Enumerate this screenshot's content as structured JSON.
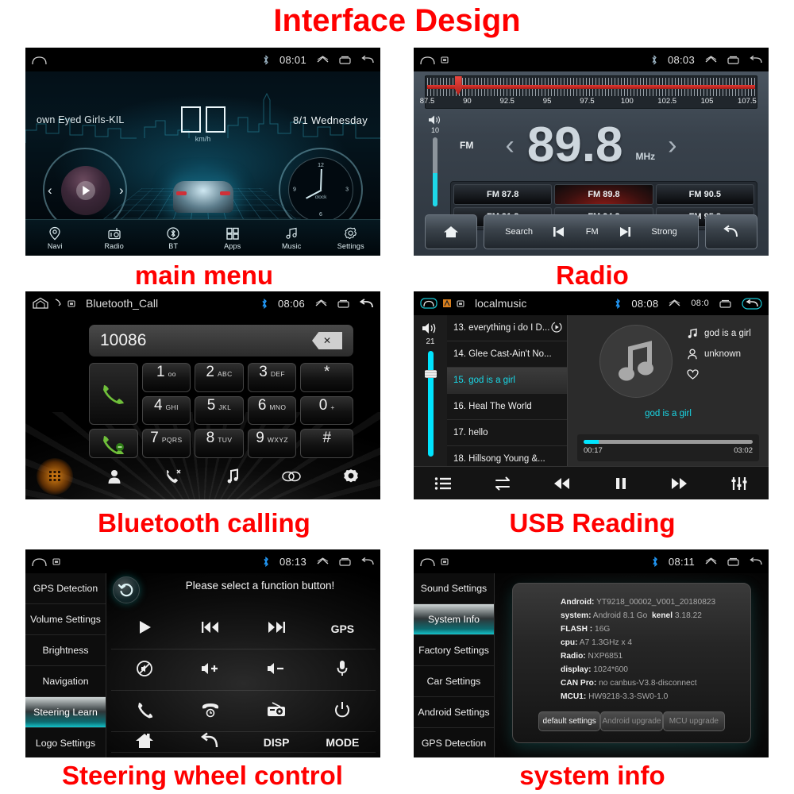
{
  "title": "Interface Design",
  "captions": {
    "main_menu": "main menu",
    "radio": "Radio",
    "bluetooth": "Bluetooth calling",
    "usb": "USB Reading",
    "steering": "Steering wheel control",
    "system": "system info"
  },
  "colors": {
    "caption_red": "#ff0000",
    "accent_cyan": "#19d7e6",
    "accent_red": "#c2201b",
    "bluetooth_blue": "#2196f3",
    "call_green": "#6fbf3a"
  },
  "main_menu": {
    "status": {
      "time": "08:01",
      "bluetooth_icon": "bluetooth-icon",
      "home_icon": "home-icon",
      "up_icon": "chevron-up-icon",
      "recents_icon": "recents-icon",
      "back_icon": "back-icon"
    },
    "track": "own Eyed Girls-KIL",
    "date": "8/1  Wednesday",
    "speed_unit": "km/h",
    "clock_label": "clock",
    "clock_numbers": [
      "12",
      "3",
      "6",
      "9"
    ],
    "taskbar": [
      {
        "label": "Navi",
        "icon": "location-pin-icon"
      },
      {
        "label": "Radio",
        "icon": "radio-icon"
      },
      {
        "label": "BT",
        "icon": "bluetooth-icon"
      },
      {
        "label": "Apps",
        "icon": "grid-apps-icon"
      },
      {
        "label": "Music",
        "icon": "music-note-icon"
      },
      {
        "label": "Settings",
        "icon": "gear-icon"
      }
    ]
  },
  "radio": {
    "status": {
      "time": "08:03"
    },
    "scale_labels": [
      "87.5",
      "90",
      "92.5",
      "95",
      "97.5",
      "100",
      "102.5",
      "105",
      "107.5"
    ],
    "scale_min": 87.5,
    "scale_max": 108.0,
    "tuned_frequency": 89.3,
    "volume": "10",
    "band": "FM",
    "frequency": "89.8",
    "unit": "MHz",
    "prev_icon": "chevron-left-icon",
    "next_icon": "chevron-right-icon",
    "presets": [
      "FM 87.8",
      "FM 89.8",
      "FM 90.5",
      "FM 91.8",
      "FM 94.2",
      "FM 95.8"
    ],
    "active_preset_index": 1,
    "bottom": {
      "home_icon": "home-icon",
      "search": "Search",
      "prev_icon": "skip-previous-icon",
      "band": "FM",
      "next_icon": "skip-next-icon",
      "strong": "Strong",
      "back_icon": "back-arrow-icon"
    }
  },
  "bluetooth": {
    "status": {
      "title": "Bluetooth_Call",
      "time": "08:06"
    },
    "dialed_number": "10086",
    "backspace_icon": "backspace-icon",
    "keys": [
      {
        "digit": "1",
        "sub": "oo"
      },
      {
        "digit": "2",
        "sub": "ABC"
      },
      {
        "digit": "3",
        "sub": "DEF"
      },
      {
        "digit": "*",
        "sub": ""
      },
      {
        "digit": "4",
        "sub": "GHI"
      },
      {
        "digit": "5",
        "sub": "JKL"
      },
      {
        "digit": "6",
        "sub": "MNO"
      },
      {
        "digit": "0",
        "sub": "+"
      },
      {
        "digit": "7",
        "sub": "PQRS"
      },
      {
        "digit": "8",
        "sub": "TUV"
      },
      {
        "digit": "9",
        "sub": "WXYZ"
      },
      {
        "digit": "#",
        "sub": ""
      }
    ],
    "call_icon": "phone-call-icon",
    "hangup_icon": "phone-hangup-icon",
    "tabs": [
      {
        "icon": "dialpad-icon",
        "active": true
      },
      {
        "icon": "contacts-icon",
        "active": false
      },
      {
        "icon": "call-history-icon",
        "active": false
      },
      {
        "icon": "music-note-icon",
        "active": false
      },
      {
        "icon": "link-icon",
        "active": false
      },
      {
        "icon": "gear-icon",
        "active": false
      }
    ]
  },
  "usb": {
    "status": {
      "title": "localmusic",
      "time": "08:08",
      "extra": "08:0"
    },
    "volume": "21",
    "playlist": [
      "13. everything i do I D...",
      "14. Glee Cast-Ain't No...",
      "15. god is a girl",
      "16. Heal The World",
      "17. hello",
      "18. Hillsong Young &..."
    ],
    "selected_index": 2,
    "now_playing": {
      "title": "god is a girl",
      "artist": "unknown",
      "favorite_icon": "heart-icon",
      "lyric": "god is a girl",
      "elapsed": "00:17",
      "duration": "03:02",
      "progress_percent": 9
    },
    "controls": [
      "list-icon",
      "repeat-icon",
      "skip-previous-icon",
      "pause-icon",
      "skip-next-icon",
      "equalizer-icon"
    ]
  },
  "steering": {
    "status": {
      "time": "08:13"
    },
    "menu": [
      "GPS Detection",
      "Volume Settings",
      "Brightness",
      "Navigation",
      "Steering Learn",
      "Logo Settings"
    ],
    "active_menu_index": 4,
    "hint": "Please select a function button!",
    "reset_icon": "reset-circle-icon",
    "buttons": [
      {
        "icon": "play-icon",
        "text": ""
      },
      {
        "icon": "skip-previous-icon",
        "text": ""
      },
      {
        "icon": "skip-next-icon",
        "text": ""
      },
      {
        "icon": "",
        "text": "GPS"
      },
      {
        "icon": "mute-icon",
        "text": ""
      },
      {
        "icon": "volume-up-icon",
        "text": ""
      },
      {
        "icon": "volume-down-icon",
        "text": ""
      },
      {
        "icon": "microphone-icon",
        "text": ""
      },
      {
        "icon": "phone-icon",
        "text": ""
      },
      {
        "icon": "phone-hangup-icon",
        "text": ""
      },
      {
        "icon": "radio-icon",
        "text": ""
      },
      {
        "icon": "power-icon",
        "text": ""
      },
      {
        "icon": "home-icon",
        "text": ""
      },
      {
        "icon": "back-arrow-icon",
        "text": ""
      },
      {
        "icon": "",
        "text": "DISP"
      },
      {
        "icon": "",
        "text": "MODE"
      }
    ]
  },
  "system": {
    "status": {
      "time": "08:11"
    },
    "menu": [
      "Sound Settings",
      "System Info",
      "Factory Settings",
      "Car Settings",
      "Android Settings",
      "GPS Detection"
    ],
    "active_menu_index": 1,
    "info": [
      {
        "label": "Android:",
        "value": "YT9218_00002_V001_20180823"
      },
      {
        "label": "system:",
        "value": "Android 8.1 Go",
        "label2": "kenel",
        "value2": "3.18.22"
      },
      {
        "label": "FLASH :",
        "value": "16G"
      },
      {
        "label": "cpu:",
        "value": "A7 1.3GHz x 4"
      },
      {
        "label": "Radio:",
        "value": "NXP6851"
      },
      {
        "label": "display:",
        "value": "1024*600"
      },
      {
        "label": "CAN Pro:",
        "value": "no canbus-V3.8-disconnect"
      },
      {
        "label": "MCU1:",
        "value": "HW9218-3.3-SW0-1.0"
      }
    ],
    "buttons": [
      {
        "label": "default settings",
        "enabled": true
      },
      {
        "label": "Android upgrade",
        "enabled": false
      },
      {
        "label": "MCU upgrade",
        "enabled": false
      }
    ]
  }
}
